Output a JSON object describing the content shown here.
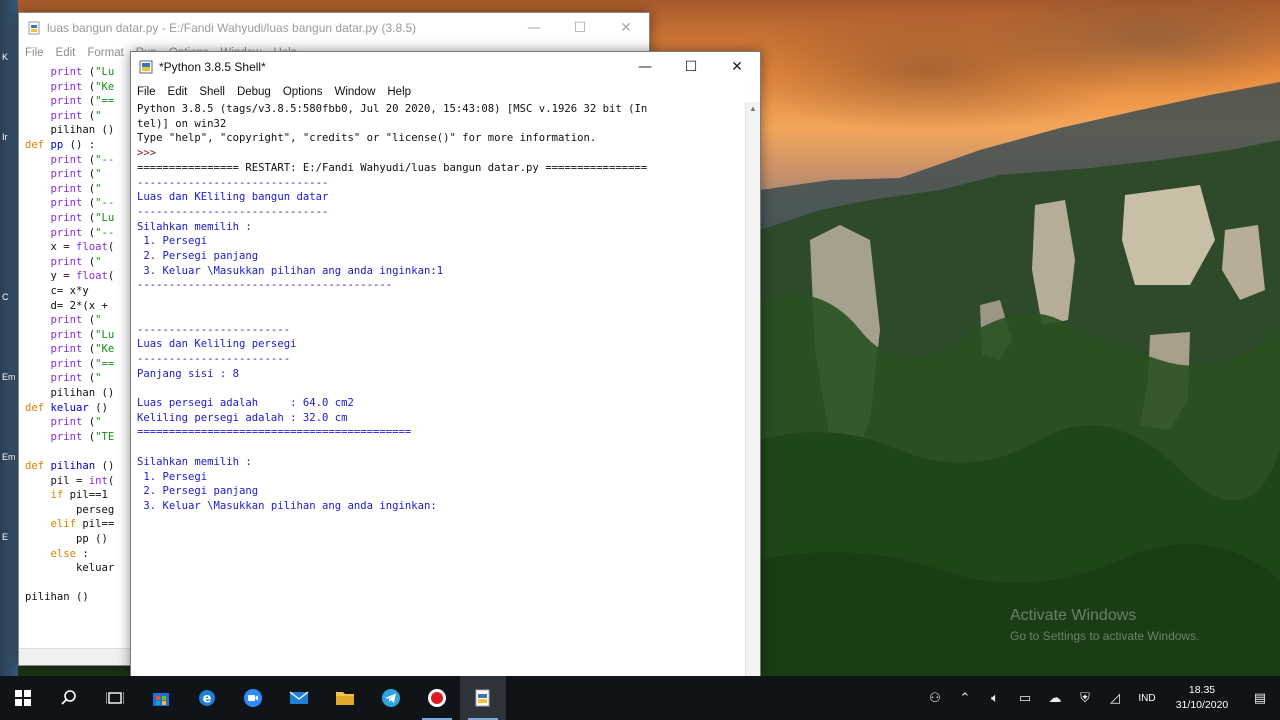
{
  "editor": {
    "title": "luas bangun datar.py - E:/Fandi Wahyudi/luas bangun datar.py (3.8.5)",
    "menu": [
      "File",
      "Edit",
      "Format",
      "Run",
      "Options",
      "Window",
      "Help"
    ],
    "code_lines": [
      [
        {
          "c": "pl",
          "t": "    "
        },
        {
          "c": "bi",
          "t": "print"
        },
        {
          "c": "pl",
          "t": " ("
        },
        {
          "c": "st",
          "t": "\"Lu"
        }
      ],
      [
        {
          "c": "pl",
          "t": "    "
        },
        {
          "c": "bi",
          "t": "print"
        },
        {
          "c": "pl",
          "t": " ("
        },
        {
          "c": "st",
          "t": "\"Ke"
        }
      ],
      [
        {
          "c": "pl",
          "t": "    "
        },
        {
          "c": "bi",
          "t": "print"
        },
        {
          "c": "pl",
          "t": " ("
        },
        {
          "c": "st",
          "t": "\"=="
        }
      ],
      [
        {
          "c": "pl",
          "t": "    "
        },
        {
          "c": "bi",
          "t": "print"
        },
        {
          "c": "pl",
          "t": " ("
        },
        {
          "c": "st",
          "t": "\" "
        }
      ],
      [
        {
          "c": "pl",
          "t": "    pilihan ()"
        }
      ],
      [
        {
          "c": "kw",
          "t": "def"
        },
        {
          "c": "pl",
          "t": " "
        },
        {
          "c": "df",
          "t": "pp"
        },
        {
          "c": "pl",
          "t": " () :"
        }
      ],
      [
        {
          "c": "pl",
          "t": "    "
        },
        {
          "c": "bi",
          "t": "print"
        },
        {
          "c": "pl",
          "t": " ("
        },
        {
          "c": "st",
          "t": "\"--"
        }
      ],
      [
        {
          "c": "pl",
          "t": "    "
        },
        {
          "c": "bi",
          "t": "print"
        },
        {
          "c": "pl",
          "t": " ("
        },
        {
          "c": "st",
          "t": "\" "
        }
      ],
      [
        {
          "c": "pl",
          "t": "    "
        },
        {
          "c": "bi",
          "t": "print"
        },
        {
          "c": "pl",
          "t": " ("
        },
        {
          "c": "st",
          "t": "\" "
        }
      ],
      [
        {
          "c": "pl",
          "t": "    "
        },
        {
          "c": "bi",
          "t": "print"
        },
        {
          "c": "pl",
          "t": " ("
        },
        {
          "c": "st",
          "t": "\"--"
        }
      ],
      [
        {
          "c": "pl",
          "t": "    "
        },
        {
          "c": "bi",
          "t": "print"
        },
        {
          "c": "pl",
          "t": " ("
        },
        {
          "c": "st",
          "t": "\"Lu"
        }
      ],
      [
        {
          "c": "pl",
          "t": "    "
        },
        {
          "c": "bi",
          "t": "print"
        },
        {
          "c": "pl",
          "t": " ("
        },
        {
          "c": "st",
          "t": "\"--"
        }
      ],
      [
        {
          "c": "pl",
          "t": "    x = "
        },
        {
          "c": "bi",
          "t": "float"
        },
        {
          "c": "pl",
          "t": "("
        }
      ],
      [
        {
          "c": "pl",
          "t": "    "
        },
        {
          "c": "bi",
          "t": "print"
        },
        {
          "c": "pl",
          "t": " ("
        },
        {
          "c": "st",
          "t": "\" "
        }
      ],
      [
        {
          "c": "pl",
          "t": "    y = "
        },
        {
          "c": "bi",
          "t": "float"
        },
        {
          "c": "pl",
          "t": "("
        }
      ],
      [
        {
          "c": "pl",
          "t": "    c= x*y"
        }
      ],
      [
        {
          "c": "pl",
          "t": "    d= 2*(x +"
        }
      ],
      [
        {
          "c": "pl",
          "t": "    "
        },
        {
          "c": "bi",
          "t": "print"
        },
        {
          "c": "pl",
          "t": " ("
        },
        {
          "c": "st",
          "t": "\" "
        }
      ],
      [
        {
          "c": "pl",
          "t": "    "
        },
        {
          "c": "bi",
          "t": "print"
        },
        {
          "c": "pl",
          "t": " ("
        },
        {
          "c": "st",
          "t": "\"Lu"
        }
      ],
      [
        {
          "c": "pl",
          "t": "    "
        },
        {
          "c": "bi",
          "t": "print"
        },
        {
          "c": "pl",
          "t": " ("
        },
        {
          "c": "st",
          "t": "\"Ke"
        }
      ],
      [
        {
          "c": "pl",
          "t": "    "
        },
        {
          "c": "bi",
          "t": "print"
        },
        {
          "c": "pl",
          "t": " ("
        },
        {
          "c": "st",
          "t": "\"=="
        }
      ],
      [
        {
          "c": "pl",
          "t": "    "
        },
        {
          "c": "bi",
          "t": "print"
        },
        {
          "c": "pl",
          "t": " ("
        },
        {
          "c": "st",
          "t": "\" "
        }
      ],
      [
        {
          "c": "pl",
          "t": "    pilihan ()"
        }
      ],
      [
        {
          "c": "kw",
          "t": "def"
        },
        {
          "c": "pl",
          "t": " "
        },
        {
          "c": "df",
          "t": "keluar"
        },
        {
          "c": "pl",
          "t": " ()"
        }
      ],
      [
        {
          "c": "pl",
          "t": "    "
        },
        {
          "c": "bi",
          "t": "print"
        },
        {
          "c": "pl",
          "t": " ("
        },
        {
          "c": "st",
          "t": "\" "
        }
      ],
      [
        {
          "c": "pl",
          "t": "    "
        },
        {
          "c": "bi",
          "t": "print"
        },
        {
          "c": "pl",
          "t": " ("
        },
        {
          "c": "st",
          "t": "\"TE"
        }
      ],
      [
        {
          "c": "pl",
          "t": ""
        }
      ],
      [
        {
          "c": "kw",
          "t": "def"
        },
        {
          "c": "pl",
          "t": " "
        },
        {
          "c": "df",
          "t": "pilihan"
        },
        {
          "c": "pl",
          "t": " ()"
        }
      ],
      [
        {
          "c": "pl",
          "t": "    pil = "
        },
        {
          "c": "bi",
          "t": "int"
        },
        {
          "c": "pl",
          "t": "("
        }
      ],
      [
        {
          "c": "pl",
          "t": "    "
        },
        {
          "c": "kw",
          "t": "if"
        },
        {
          "c": "pl",
          "t": " pil==1"
        }
      ],
      [
        {
          "c": "pl",
          "t": "        perseg"
        }
      ],
      [
        {
          "c": "pl",
          "t": "    "
        },
        {
          "c": "kw",
          "t": "elif"
        },
        {
          "c": "pl",
          "t": " pil=="
        }
      ],
      [
        {
          "c": "pl",
          "t": "        pp ()"
        }
      ],
      [
        {
          "c": "pl",
          "t": "    "
        },
        {
          "c": "kw",
          "t": "else"
        },
        {
          "c": "pl",
          "t": " :"
        }
      ],
      [
        {
          "c": "pl",
          "t": "        keluar"
        }
      ],
      [
        {
          "c": "pl",
          "t": ""
        }
      ],
      [
        {
          "c": "pl",
          "t": "pilihan ()"
        }
      ]
    ]
  },
  "shell": {
    "title": "*Python 3.8.5 Shell*",
    "menu": [
      "File",
      "Edit",
      "Shell",
      "Debug",
      "Options",
      "Window",
      "Help"
    ],
    "lines": [
      {
        "c": "sys",
        "t": "Python 3.8.5 (tags/v3.8.5:580fbb0, Jul 20 2020, 15:43:08) [MSC v.1926 32 bit (In"
      },
      {
        "c": "sys",
        "t": "tel)] on win32"
      },
      {
        "c": "sys",
        "t": "Type \"help\", \"copyright\", \"credits\" or \"license()\" for more information."
      },
      {
        "c": "prompt",
        "t": ">>> "
      },
      {
        "c": "restart",
        "t": "================ RESTART: E:/Fandi Wahyudi/luas bangun datar.py ================"
      },
      {
        "c": "out",
        "t": "------------------------------"
      },
      {
        "c": "out",
        "t": "Luas dan KEliling bangun datar"
      },
      {
        "c": "out",
        "t": "------------------------------"
      },
      {
        "c": "out",
        "t": "Silahkan memilih :"
      },
      {
        "c": "out",
        "t": " 1. Persegi"
      },
      {
        "c": "out",
        "t": " 2. Persegi panjang"
      },
      {
        "c": "out",
        "t": " 3. Keluar \\Masukkan pilihan ang anda inginkan:1"
      },
      {
        "c": "out",
        "t": "----------------------------------------"
      },
      {
        "c": "out",
        "t": ""
      },
      {
        "c": "out",
        "t": ""
      },
      {
        "c": "out",
        "t": "------------------------"
      },
      {
        "c": "out",
        "t": "Luas dan Keliling persegi"
      },
      {
        "c": "out",
        "t": "------------------------"
      },
      {
        "c": "out",
        "t": "Panjang sisi : 8"
      },
      {
        "c": "out",
        "t": ""
      },
      {
        "c": "out",
        "t": "Luas persegi adalah     : 64.0 cm2"
      },
      {
        "c": "out",
        "t": "Keliling persegi adalah : 32.0 cm"
      },
      {
        "c": "out",
        "t": "==========================================="
      },
      {
        "c": "out",
        "t": ""
      },
      {
        "c": "out",
        "t": "Silahkan memilih :"
      },
      {
        "c": "out",
        "t": " 1. Persegi"
      },
      {
        "c": "out",
        "t": " 2. Persegi panjang"
      },
      {
        "c": "out",
        "t": " 3. Keluar \\Masukkan pilihan ang anda inginkan:"
      }
    ]
  },
  "desktop": {
    "watermark_line1": "Activate Windows",
    "watermark_line2": "Go to Settings to activate Windows."
  },
  "window_controls": {
    "minimize": "—",
    "maximize": "☐",
    "close": "✕"
  },
  "taskbar": {
    "language": "IND",
    "time": "18.35",
    "date": "31/10/2020"
  },
  "colors": {
    "shell_output": "#1a1ad4",
    "taskbar": "#101418"
  }
}
